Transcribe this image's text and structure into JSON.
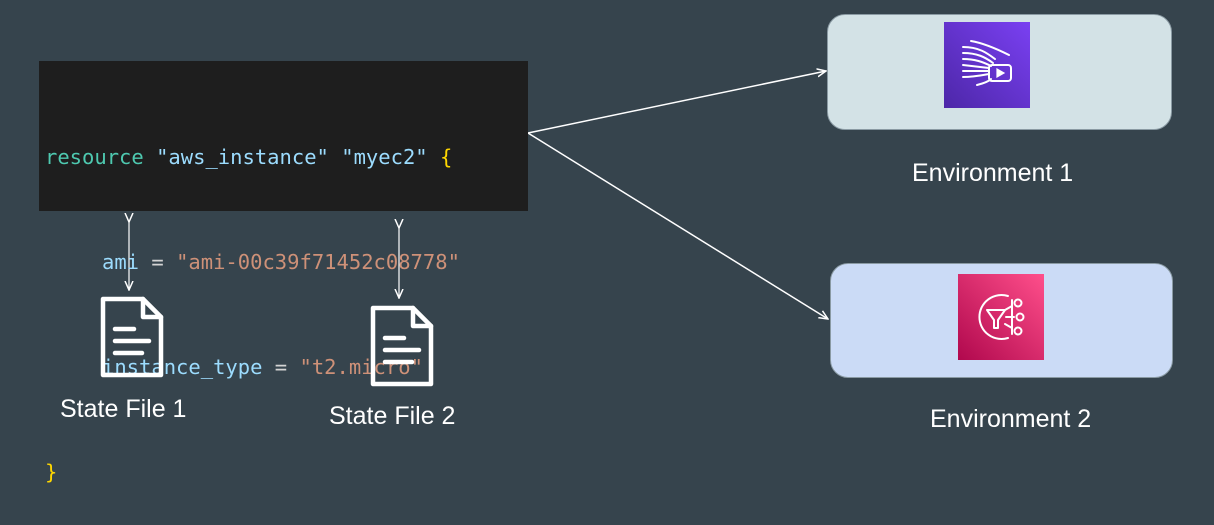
{
  "code": {
    "line1": {
      "keyword": "resource",
      "type": "\"aws_instance\"",
      "name": "\"myec2\"",
      "open_brace": "{"
    },
    "line2": {
      "attr": "ami",
      "op": "=",
      "value": "\"ami-00c39f71452c08778\""
    },
    "line3": {
      "attr": "instance_type",
      "op": "=",
      "value": "\"t2.micro\""
    },
    "line4": {
      "close_brace": "}"
    }
  },
  "environments": [
    {
      "label": "Environment 1",
      "icon": "aws-elemental-media-icon",
      "bg_color": "#d3e2e6",
      "icon_color": "#7a40f2"
    },
    {
      "label": "Environment 2",
      "icon": "aws-sns-icon",
      "bg_color": "#cbdbf6",
      "icon_color": "#e7157b"
    }
  ],
  "state_files": [
    {
      "label": "State File 1",
      "icon": "document-icon"
    },
    {
      "label": "State File 2",
      "icon": "document-icon"
    }
  ],
  "colors": {
    "background": "#36444d",
    "code_background": "#1e1e1e",
    "connector": "#ffffff"
  }
}
